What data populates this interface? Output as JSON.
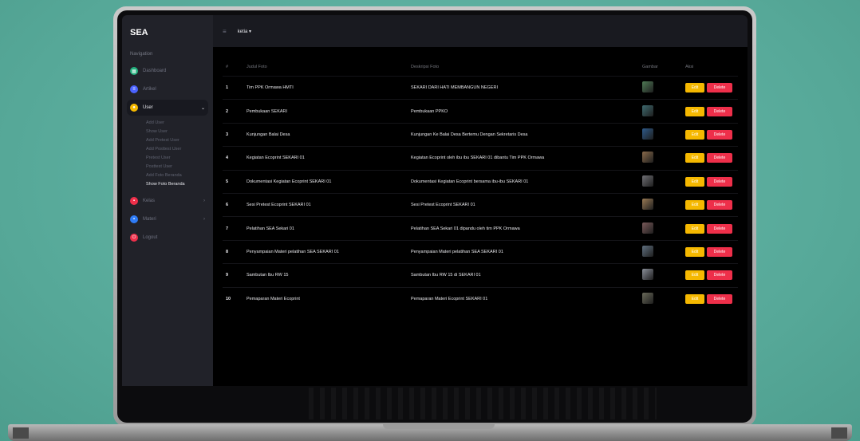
{
  "sidebar": {
    "brand": "SEA",
    "heading": "Navigation",
    "items": [
      {
        "label": "Dashboard",
        "icon": "dashboard-icon",
        "color": "#22b07d"
      },
      {
        "label": "Artikel",
        "icon": "article-icon",
        "color": "#4b63ff"
      },
      {
        "label": "User",
        "icon": "user-icon",
        "color": "#f5b800"
      },
      {
        "label": "Kelas",
        "icon": "class-icon",
        "color": "#ee2f4a"
      },
      {
        "label": "Materi",
        "icon": "book-icon",
        "color": "#2f7cf6"
      },
      {
        "label": "Logout",
        "icon": "logout-icon",
        "color": "#ee2f4a"
      }
    ],
    "sub_items": [
      "Add User",
      "Show User",
      "Add Pretest User",
      "Add Posttest User",
      "Pretest User",
      "Posttest User",
      "Add Foto Beranda",
      "Show Foto Beranda"
    ]
  },
  "topbar": {
    "user": "ketia ▾"
  },
  "table": {
    "headers": [
      "#",
      "Judul Foto",
      "Deskripsi Foto",
      "Gambar",
      "Aksi"
    ],
    "edit_label": "Edit",
    "delete_label": "Delete",
    "rows": [
      {
        "no": "1",
        "judul": "Tim PPK Ormawa HMTI",
        "deskripsi": "SEKARI DARI HATI MEMBANGUN NEGERI",
        "thumb": "#4f7a55"
      },
      {
        "no": "2",
        "judul": "Pembukaan SEKARI",
        "deskripsi": "Pembukaan PPKO",
        "thumb": "#3e6a6f"
      },
      {
        "no": "3",
        "judul": "Kunjungan Balai Desa",
        "deskripsi": "Kunjungan Ke Balai Desa Bertemu Dengan Sekretaris Desa",
        "thumb": "#2e5a8a"
      },
      {
        "no": "4",
        "judul": "Kegiatan Ecoprint SEKARI 01",
        "deskripsi": "Kegiatan Ecoprint oleh ibu ibu SEKARI 01 dibantu Tim PPK Ormawa",
        "thumb": "#8a6a4a"
      },
      {
        "no": "5",
        "judul": "Dokumentasi Kegiatan Ecoprint SEKARI 01",
        "deskripsi": "Dokumentasi Kegiatan Ecoprint bersama ibu-ibu SEKARI 01",
        "thumb": "#6f6f74"
      },
      {
        "no": "6",
        "judul": "Sesi Pretest Ecoprint SEKARI 01",
        "deskripsi": "Sesi Pretest Ecoprint SEKARI 01",
        "thumb": "#9a7a54"
      },
      {
        "no": "7",
        "judul": "Pelatihan SEA Sekari 01",
        "deskripsi": "Pelatihan SEA Sekari 01 dipandu oleh tim PPK Ormawa",
        "thumb": "#7a5a5a"
      },
      {
        "no": "8",
        "judul": "Penyampaian Materi pelatihan SEA SEKARI 01",
        "deskripsi": "Penyampaian Materi pelatihan SEA SEKARI 01",
        "thumb": "#5f6f7f"
      },
      {
        "no": "9",
        "judul": "Sambutan Ibu RW 15",
        "deskripsi": "Sambutan Ibu RW 15 di SEKARI 01",
        "thumb": "#8a8f99"
      },
      {
        "no": "10",
        "judul": "Pemaparan Materi Ecoprint",
        "deskripsi": "Pemaparan Materi Ecoprint SEKARI 01",
        "thumb": "#6a6a5a"
      }
    ]
  }
}
